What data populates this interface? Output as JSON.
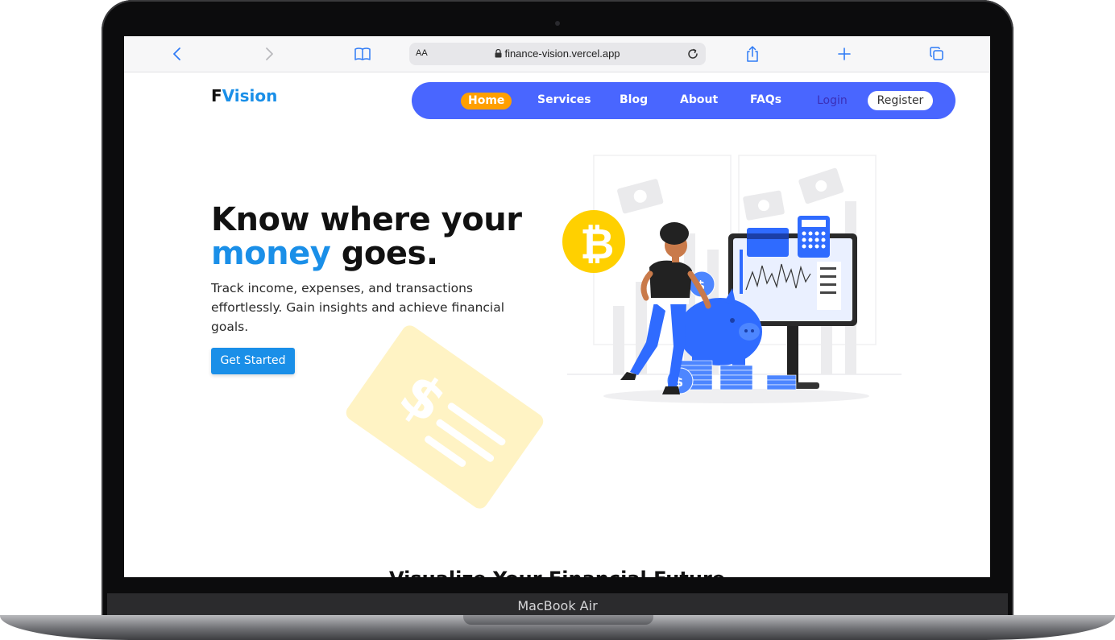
{
  "browser": {
    "url_aa": "AA",
    "url": "finance-vision.vercel.app"
  },
  "site": {
    "logo_prefix": "F",
    "logo_suffix": "Vision",
    "nav": {
      "home": "Home",
      "services": "Services",
      "blog": "Blog",
      "about": "About",
      "faqs": "FAQs",
      "login": "Login",
      "register": "Register"
    },
    "hero": {
      "headline_line1": "Know where your",
      "headline_blue": "money",
      "headline_rest": " goes.",
      "subtext": "Track income, expenses, and transactions effortlessly. Gain insights and achieve financial goals.",
      "cta": "Get Started"
    },
    "next_section_title": "Visualize Your Financial Future"
  },
  "device": {
    "label": "MacBook Air"
  },
  "colors": {
    "accent_blue": "#1a8fe8",
    "nav_bg": "#4966ff",
    "home_pill": "#ff9f00",
    "bitcoin": "#ffd000"
  }
}
